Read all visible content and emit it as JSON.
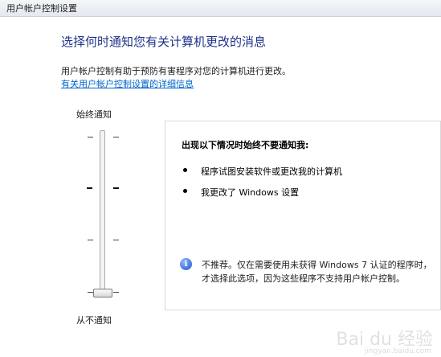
{
  "window": {
    "title": "用户帐户控制设置"
  },
  "main": {
    "heading": "选择何时通知您有关计算机更改的消息",
    "description": "用户帐户控制有助于预防有害程序对您的计算机进行更改。",
    "link": "有关用户帐户控制设置的详细信息"
  },
  "slider": {
    "top_label": "始终通知",
    "bottom_label": "从不通知",
    "levels": 4,
    "selected_level": 1
  },
  "panel": {
    "heading": "出现以下情况时始终不要通知我:",
    "bullets": [
      "程序试图安装软件或更改我的计算机",
      "我更改了 Windows 设置"
    ],
    "info_icon": "info-icon",
    "warning": "不推荐。仅在需要使用未获得 Windows 7 认证的程序时，才选择此选项，因为这些程序不支持用户帐户控制。"
  },
  "watermark": {
    "text": "Bai du 经验",
    "sub": "jingyan.baidu.com"
  },
  "colors": {
    "heading": "#1e3287",
    "link": "#0066cc"
  }
}
